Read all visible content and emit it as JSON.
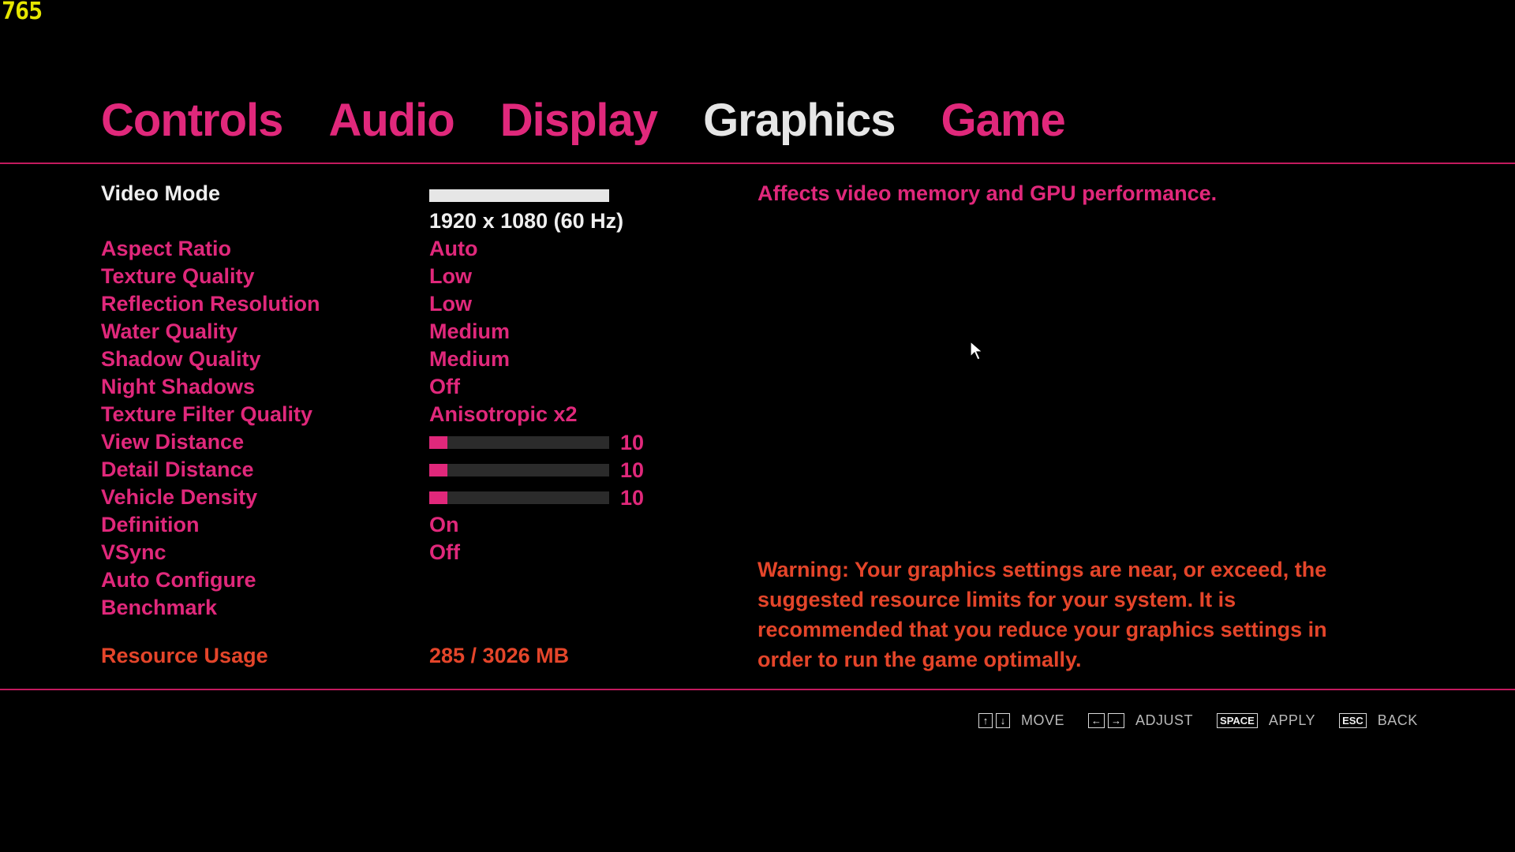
{
  "fps_counter": "765",
  "tabs": [
    {
      "label": "Controls",
      "active": false
    },
    {
      "label": "Audio",
      "active": false
    },
    {
      "label": "Display",
      "active": false
    },
    {
      "label": "Graphics",
      "active": true
    },
    {
      "label": "Game",
      "active": false
    }
  ],
  "settings": {
    "video_mode": {
      "label": "Video Mode",
      "value": "1920 x 1080 (60 Hz)"
    },
    "aspect_ratio": {
      "label": "Aspect Ratio",
      "value": "Auto"
    },
    "texture_quality": {
      "label": "Texture Quality",
      "value": "Low"
    },
    "reflection_resolution": {
      "label": "Reflection Resolution",
      "value": "Low"
    },
    "water_quality": {
      "label": "Water Quality",
      "value": "Medium"
    },
    "shadow_quality": {
      "label": "Shadow Quality",
      "value": "Medium"
    },
    "night_shadows": {
      "label": "Night Shadows",
      "value": "Off"
    },
    "texture_filter_quality": {
      "label": "Texture Filter Quality",
      "value": "Anisotropic x2"
    },
    "view_distance": {
      "label": "View Distance",
      "value": "10",
      "level_percent": 10
    },
    "detail_distance": {
      "label": "Detail Distance",
      "value": "10",
      "level_percent": 10
    },
    "vehicle_density": {
      "label": "Vehicle Density",
      "value": "10",
      "level_percent": 10
    },
    "definition": {
      "label": "Definition",
      "value": "On"
    },
    "vsync": {
      "label": "VSync",
      "value": "Off"
    },
    "auto_configure": {
      "label": "Auto Configure"
    },
    "benchmark": {
      "label": "Benchmark"
    },
    "resource_usage": {
      "label": "Resource Usage",
      "value": "285 / 3026 MB"
    }
  },
  "description": "Affects video memory and GPU performance.",
  "warning": "Warning: Your graphics settings are near, or exceed, the suggested resource limits for your system. It is recommended that you reduce your graphics settings in order to run the game optimally.",
  "hints": {
    "move_keys": [
      "↑",
      "↓"
    ],
    "move_label": "MOVE",
    "adjust_keys": [
      "←",
      "→"
    ],
    "adjust_label": "ADJUST",
    "apply_key": "SPACE",
    "apply_label": "APPLY",
    "back_key": "ESC",
    "back_label": "BACK"
  },
  "colors": {
    "accent_pink": "#e0287b",
    "warning_orange": "#e4452a",
    "selected_white": "#efefef",
    "fps_yellow": "#e6e600"
  }
}
